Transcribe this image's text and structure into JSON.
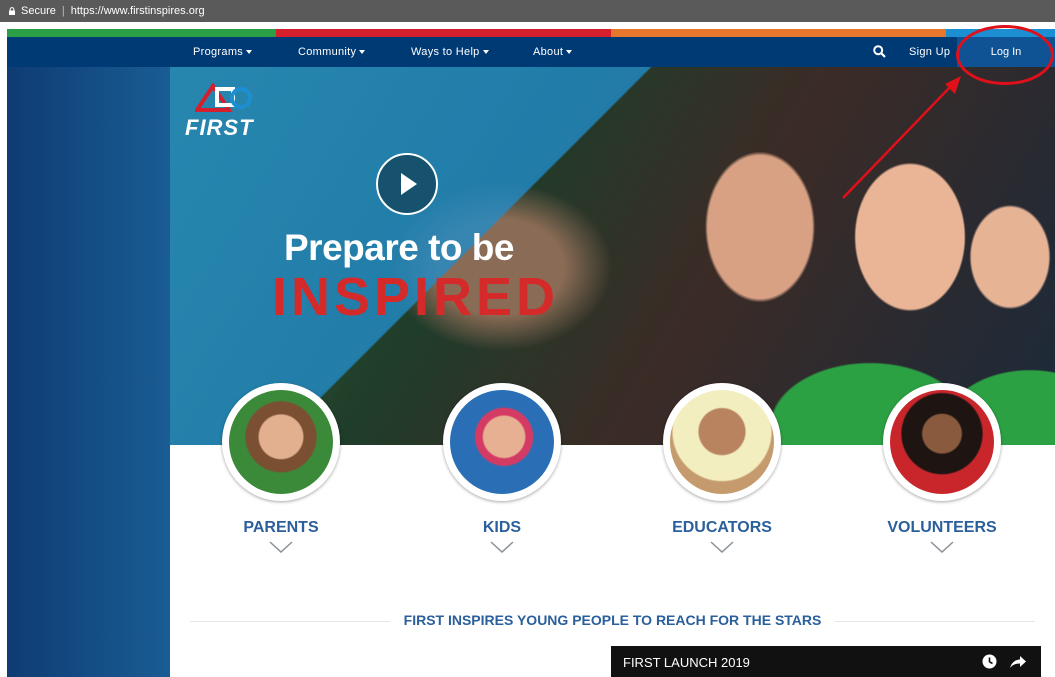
{
  "browser": {
    "secure_label": "Secure",
    "url": "https://www.firstinspires.org"
  },
  "colors": {
    "strip": [
      "#2a9f45",
      "#d4202c",
      "#e8772e",
      "#1c8fd2"
    ],
    "nav_bg": "#003a75",
    "accent_red": "#d42a2a",
    "accent_blue": "#2b5f9c",
    "annotation": "#e0101a"
  },
  "nav": {
    "items": [
      {
        "label": "Programs"
      },
      {
        "label": "Community"
      },
      {
        "label": "Ways to Help"
      },
      {
        "label": "About"
      }
    ],
    "search_icon": "search-icon",
    "signup_label": "Sign Up",
    "login_label": "Log In"
  },
  "hero": {
    "logo_text": "FIRST",
    "line1": "Prepare to be",
    "line2": "INSPIRED"
  },
  "personas": [
    {
      "label": "PARENTS"
    },
    {
      "label": "KIDS"
    },
    {
      "label": "EDUCATORS"
    },
    {
      "label": "VOLUNTEERS"
    }
  ],
  "tagline": "FIRST INSPIRES YOUNG PEOPLE TO REACH FOR THE STARS",
  "video": {
    "title": "FIRST LAUNCH 2019",
    "icons": [
      "clock-icon",
      "share-icon"
    ]
  }
}
